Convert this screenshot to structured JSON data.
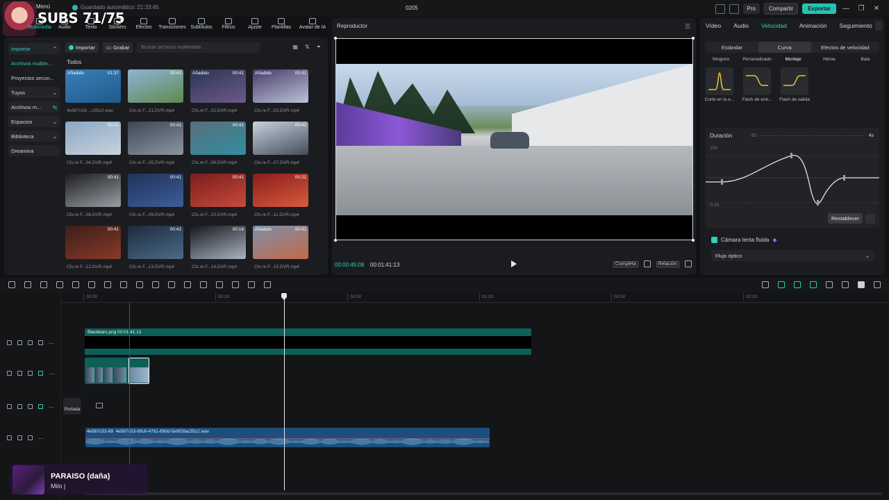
{
  "titlebar": {
    "menu": "Menú",
    "autosave": "Guardado automático: 21:33:45",
    "project": "0205",
    "pro": "Pro",
    "share": "Compartir",
    "export": "Exportar"
  },
  "overlay": {
    "subs": "SUBS 71/75"
  },
  "categories": [
    {
      "label": "Multimedia"
    },
    {
      "label": "Audio"
    },
    {
      "label": "Texto"
    },
    {
      "label": "Stickers"
    },
    {
      "label": "Efectos"
    },
    {
      "label": "Transiciones"
    },
    {
      "label": "Subtítulos"
    },
    {
      "label": "Filtros"
    },
    {
      "label": "Ajuste"
    },
    {
      "label": "Plantillas"
    },
    {
      "label": "Avatar de IA"
    }
  ],
  "sidebar": {
    "items": [
      {
        "label": "Importar"
      },
      {
        "label": "Archivos multim..."
      },
      {
        "label": "Proyectos secun..."
      },
      {
        "label": "Tuyos"
      },
      {
        "label": "Archivos m..."
      },
      {
        "label": "Espacios"
      },
      {
        "label": "Biblioteca"
      },
      {
        "label": "Dreamina"
      }
    ]
  },
  "media_toolbar": {
    "import": "Importar",
    "record": "Grabar",
    "search_placeholder": "Buscar archivos multimedia",
    "all": "Todos"
  },
  "media": [
    {
      "name": "4e567c53-...c55c2.wav",
      "duration": "01:37",
      "added": "Añadido",
      "colors": [
        "#3a7fb8",
        "#1f5a8c"
      ]
    },
    {
      "name": "Cfx.re  F...21.DVR.mp4",
      "duration": "00:41",
      "added": "",
      "colors": [
        "#8fb3d6",
        "#5e8a4f"
      ]
    },
    {
      "name": "Cfx.re  F...02.DVR.mp4",
      "duration": "00:41",
      "added": "Añadido",
      "colors": [
        "#2a3552",
        "#6d5a8a"
      ]
    },
    {
      "name": "Cfx.re  F...03.DVR.mp4",
      "duration": "00:41",
      "added": "Añadido",
      "colors": [
        "#4a3b6b",
        "#b9c4d6"
      ]
    },
    {
      "name": "Cfx.re  F...04.DVR.mp4",
      "duration": "00:41",
      "added": "",
      "colors": [
        "#8aa7c4",
        "#c9d2dc"
      ]
    },
    {
      "name": "Cfx.re  F...05.DVR.mp4",
      "duration": "00:41",
      "added": "",
      "colors": [
        "#3d4654",
        "#8b96a3"
      ]
    },
    {
      "name": "Cfx.re  F...06.DVR.mp4",
      "duration": "00:41",
      "added": "",
      "colors": [
        "#5b6d7c",
        "#2f8f9f"
      ]
    },
    {
      "name": "Cfx.re  F...07.DVR.mp4",
      "duration": "00:41",
      "added": "",
      "colors": [
        "#c7d3e0",
        "#444c58"
      ]
    },
    {
      "name": "Cfx.re  F...08.DVR.mp4",
      "duration": "00:41",
      "added": "",
      "colors": [
        "#1b1c20",
        "#9a9ea4"
      ]
    },
    {
      "name": "Cfx.re  F...09.DVR.mp4",
      "duration": "00:41",
      "added": "",
      "colors": [
        "#203459",
        "#3e5c9a"
      ]
    },
    {
      "name": "Cfx.re  F...10.DVR.mp4",
      "duration": "00:41",
      "added": "",
      "colors": [
        "#7b1c1c",
        "#c84a3b"
      ]
    },
    {
      "name": "Cfx.re  F...11.DVR.mp4",
      "duration": "00:22",
      "added": "",
      "colors": [
        "#8a1d1d",
        "#d85a3c"
      ]
    },
    {
      "name": "Cfx.re  F...12.DVR.mp4",
      "duration": "00:41",
      "added": "",
      "colors": [
        "#3a1f1a",
        "#8a3a28"
      ]
    },
    {
      "name": "Cfx.re  F...13.DVR.mp4",
      "duration": "00:41",
      "added": "",
      "colors": [
        "#1e2a3b",
        "#4a6b8a"
      ]
    },
    {
      "name": "Cfx.re  F...14.DVR.mp4",
      "duration": "00:14",
      "added": "",
      "colors": [
        "#15171c",
        "#a9b4c2"
      ]
    },
    {
      "name": "Cfx.re  F...15.DVR.mp4",
      "duration": "00:41",
      "added": "Añadido",
      "colors": [
        "#7e8fa8",
        "#c26a4a"
      ]
    }
  ],
  "player": {
    "title": "Reproductor",
    "current": "00:00:45:08",
    "total": "00:01:41:13",
    "full": "Completa",
    "ratio": "Relación"
  },
  "right_panel": {
    "tabs": [
      "Vídeo",
      "Audio",
      "Velocidad",
      "Animación",
      "Seguimiento"
    ],
    "active_tab": "Velocidad",
    "subtabs": [
      "Estándar",
      "Curva",
      "Efectos de velocidad"
    ],
    "presets_row1": [
      "Ninguno",
      "Personalizado",
      "Montaje",
      "Héroe",
      "Bala"
    ],
    "presets_row2": [
      "Corte en la e...",
      "Flash de entr...",
      "Flash de salida"
    ],
    "duration_label": "Duración",
    "duration_from": "6s",
    "duration_to": "4s",
    "y_max": "10x",
    "y_min": "0.1x",
    "reset": "Restablecer",
    "smooth_label": "Cámara lenta fluida",
    "flow": "Flujo óptico"
  },
  "timeline": {
    "ruler": [
      "00:00",
      "00:30",
      "01:00",
      "01:30",
      "02:00",
      "02:30"
    ],
    "black_clip": "Blackbars.png   00:01:41:13",
    "audio_clip_a": "4e567c53-89",
    "audio_clip_b": "4e567c53-89c6-4781-890d-5e9f28ac55c2.wav",
    "cover": "Portada"
  },
  "now_playing": {
    "title": "PARAISO (daña)",
    "artist": "Milo j"
  },
  "colors": {
    "accent": "#2fd0bd",
    "export": "#27c2b0",
    "video_track": "#0e5f57",
    "audio_track": "#1c4f7e"
  }
}
